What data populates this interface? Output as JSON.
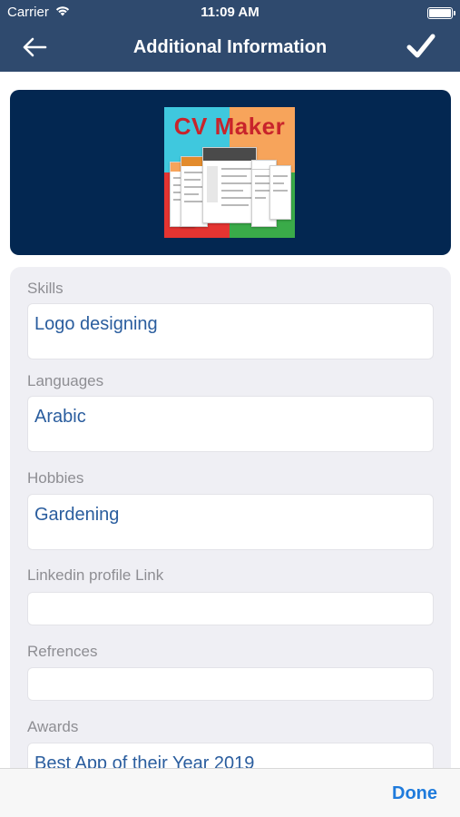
{
  "status": {
    "carrier": "Carrier",
    "time": "11:09 AM"
  },
  "nav": {
    "title": "Additional Information",
    "back_icon": "back-arrow-icon",
    "confirm_icon": "checkmark-icon"
  },
  "banner": {
    "logo_text": "CV Maker",
    "colors": {
      "background": "#032751",
      "logo_cyan": "#3fc8de",
      "logo_orange": "#f7a45b",
      "logo_red": "#e53431",
      "logo_green": "#3aab49"
    }
  },
  "form": {
    "fields": [
      {
        "label": "Skills",
        "value": "Logo designing"
      },
      {
        "label": "Languages",
        "value": "Arabic"
      },
      {
        "label": "Hobbies",
        "value": "Gardening"
      },
      {
        "label": "Linkedin profile Link",
        "value": ""
      },
      {
        "label": "Refrences",
        "value": ""
      },
      {
        "label": "Awards",
        "value": "Best App of their Year 2019"
      }
    ]
  },
  "toolbar": {
    "done_label": "Done"
  },
  "colors": {
    "nav_bar": "#2f4a6e",
    "field_value": "#2a5d9e",
    "label": "#8e8e93",
    "done": "#1f7bdc"
  }
}
